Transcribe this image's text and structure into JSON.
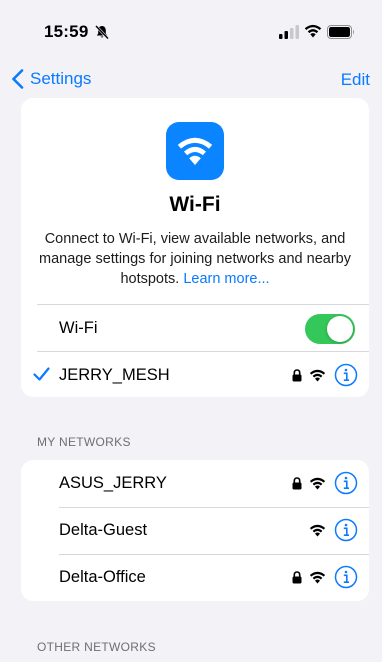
{
  "status": {
    "time": "15:59"
  },
  "nav": {
    "back_label": "Settings",
    "edit_label": "Edit"
  },
  "wifi_card": {
    "title": "Wi-Fi",
    "description": "Connect to Wi-Fi, view available networks, and manage settings for joining networks and nearby hotspots.",
    "learn_more": "Learn more...",
    "toggle_label": "Wi-Fi",
    "toggle_on": true,
    "connected_network": "JERRY_MESH"
  },
  "my_networks": {
    "header": "MY NETWORKS",
    "items": [
      {
        "name": "ASUS_JERRY",
        "secured": true
      },
      {
        "name": "Delta-Guest",
        "secured": false
      },
      {
        "name": "Delta-Office",
        "secured": true
      }
    ]
  },
  "other_networks": {
    "header": "OTHER NETWORKS"
  },
  "colors": {
    "accent": "#0a7aff",
    "toggle_on": "#34c759",
    "wifi_icon_bg": "#0a84ff",
    "background": "#f2f2f7"
  }
}
